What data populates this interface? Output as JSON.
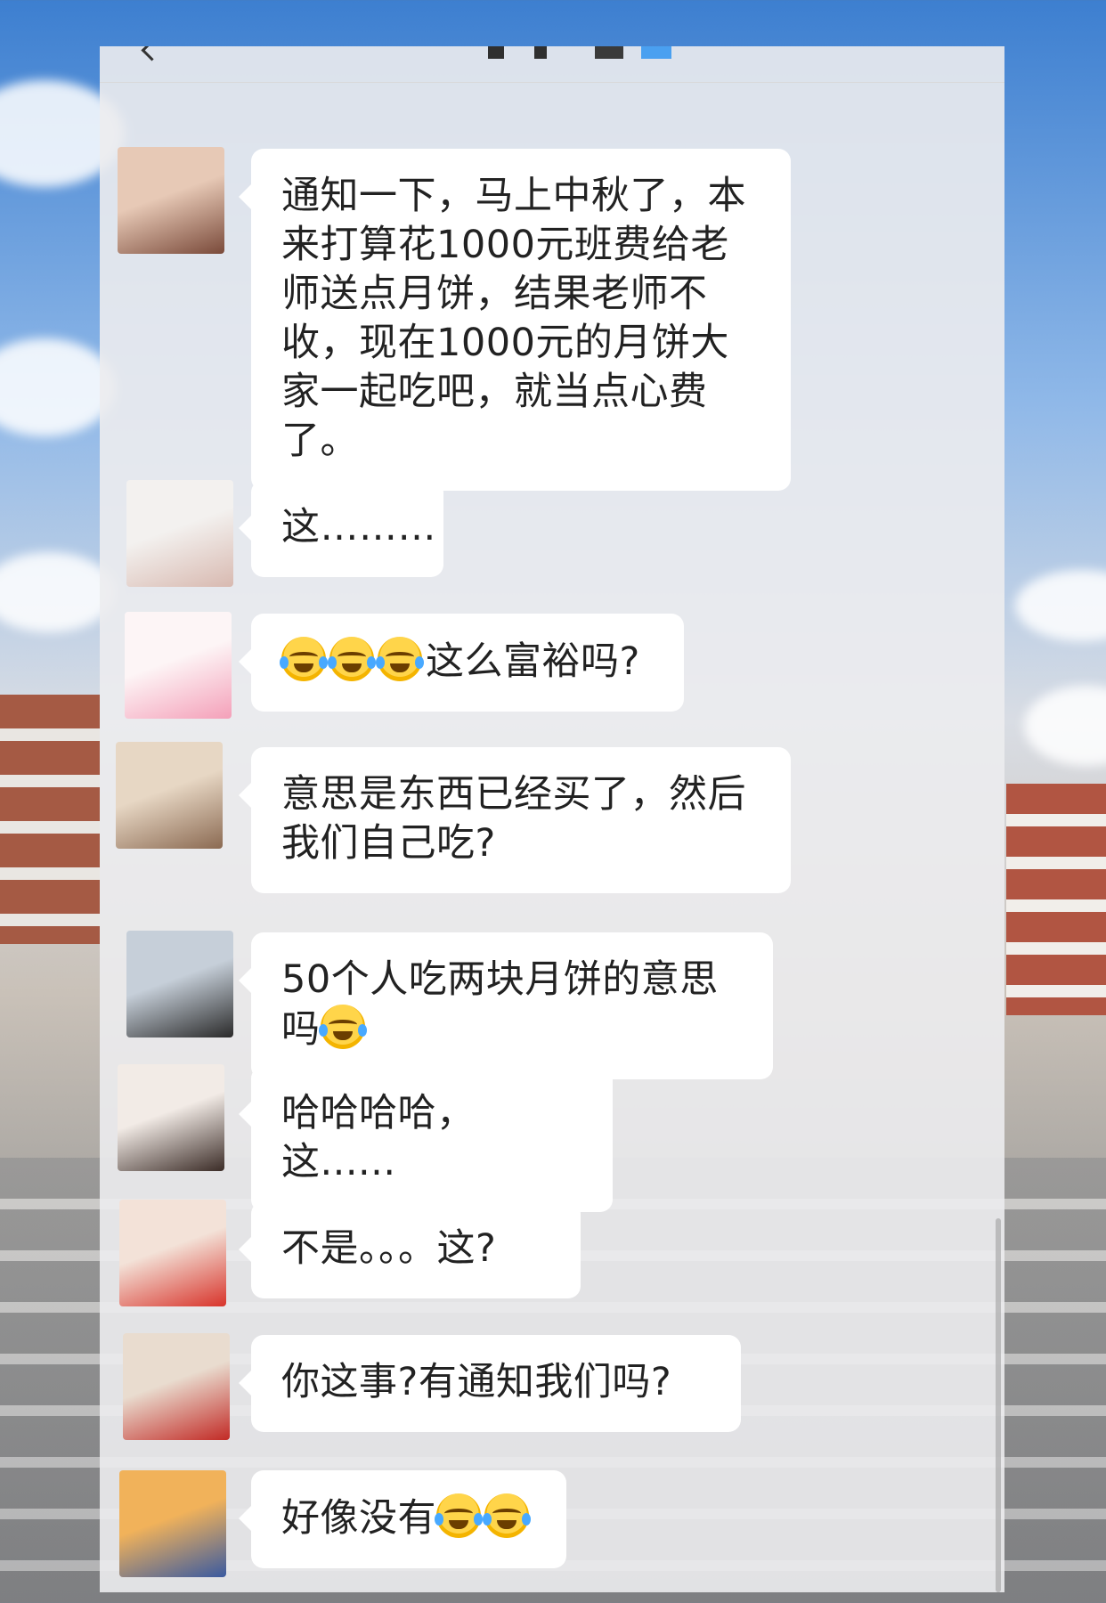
{
  "messages": [
    {
      "avatar": "avatar-girl-flower-crown",
      "avatar_colors": [
        "#e7c9b6",
        "#7a4a3a"
      ],
      "text": "通知一下，马上中秋了，本来打算花1000元班费给老师送点月饼，结果老师不收，现在1000元的月饼大家一起吃吧，就当点心费了。",
      "emojis": 0
    },
    {
      "avatar": "avatar-white-cat",
      "avatar_colors": [
        "#f3f1ef",
        "#d8b9b0"
      ],
      "text": "这………",
      "emojis": 0
    },
    {
      "avatar": "avatar-cartoon-girl-pink",
      "avatar_colors": [
        "#fdf5f6",
        "#f4a0b9"
      ],
      "text": "这么富裕吗?",
      "emojis_before": 3
    },
    {
      "avatar": "avatar-cartoon-girl-buns",
      "avatar_colors": [
        "#e7d7c4",
        "#8b6a52"
      ],
      "text": "意思是东西已经买了，然后我们自己吃?",
      "emojis": 0
    },
    {
      "avatar": "avatar-man-sunglasses",
      "avatar_colors": [
        "#c6cfd9",
        "#2a2a2a"
      ],
      "text": "50个人吃两块月饼的意思吗",
      "emojis_after": 1
    },
    {
      "avatar": "avatar-girl-sparkle",
      "avatar_colors": [
        "#f2ebe6",
        "#3b2c27"
      ],
      "text": "哈哈哈哈，这......",
      "emojis": 0
    },
    {
      "avatar": "avatar-red-apple-penguin",
      "avatar_colors": [
        "#f3e2d8",
        "#d8342b"
      ],
      "text": "不是。。。这?",
      "emojis": 0
    },
    {
      "avatar": "avatar-girl-fu-poster",
      "avatar_colors": [
        "#e9dccf",
        "#c22a25"
      ],
      "text": "你这事?有通知我们吗?",
      "emojis": 0
    },
    {
      "avatar": "avatar-sunset-hand",
      "avatar_colors": [
        "#f1b25a",
        "#3a5aa0"
      ],
      "text": "好像没有",
      "emojis_after": 2
    }
  ]
}
